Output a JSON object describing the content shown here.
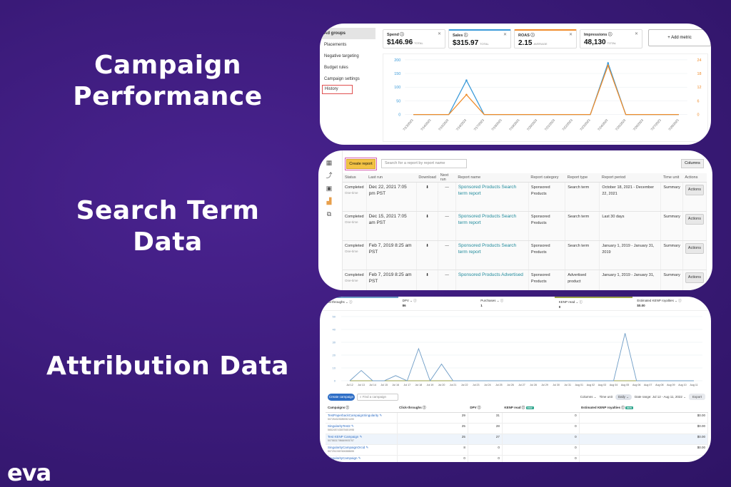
{
  "headings": {
    "campaign_performance": "Campaign Performance",
    "search_term_data": "Search Term Data",
    "attribution_data": "Attribution Data"
  },
  "logo": "eva",
  "campaign_panel": {
    "nav": [
      "Ad groups",
      "Placements",
      "Negative targeting",
      "Budget rules",
      "Campaign settings",
      "History"
    ],
    "active_nav": "Ad groups",
    "highlighted_nav": "History",
    "metrics": [
      {
        "label": "Spend",
        "value": "$146.96",
        "qualifier": "TOTAL"
      },
      {
        "label": "Sales",
        "value": "$315.97",
        "qualifier": "TOTAL",
        "color": "#3a9ad9"
      },
      {
        "label": "ROAS",
        "value": "2.15",
        "qualifier": "AVERAGE",
        "color": "#f08c2a"
      },
      {
        "label": "Impressions",
        "value": "48,130",
        "qualifier": "TOTAL"
      }
    ],
    "add_metric_label": "+ Add metric"
  },
  "search_panel": {
    "side_icons": [
      "dashboard-icon",
      "analytics-icon",
      "media-icon",
      "reports-icon",
      "copy-icon"
    ],
    "create_report_label": "Create report",
    "search_placeholder": "Search for a report by report name",
    "columns_label": "Columns",
    "headers": [
      "Status",
      "Last run",
      "Download",
      "Next run",
      "Report name",
      "Report category",
      "Report type",
      "Report period",
      "Time unit",
      "Actions"
    ],
    "rows": [
      {
        "status": "Completed",
        "frequency": "One-time",
        "last_run": "Dec 22, 2021 7:05 pm PST",
        "next_run": "—",
        "report_name": "Sponsored Products Search term report",
        "category": "Sponsored Products",
        "type": "Search term",
        "period": "October 18, 2021 - December 22, 2021",
        "time_unit": "Summary",
        "action": "Actions"
      },
      {
        "status": "Completed",
        "frequency": "One-time",
        "last_run": "Dec 15, 2021 7:05 am PST",
        "next_run": "—",
        "report_name": "Sponsored Products Search term report",
        "category": "Sponsored Products",
        "type": "Search term",
        "period": "Last 30 days",
        "time_unit": "Summary",
        "action": "Actions"
      },
      {
        "status": "Completed",
        "frequency": "One-time",
        "last_run": "Feb 7, 2019 8:25 am PST",
        "next_run": "—",
        "report_name": "Sponsored Products Search term report",
        "category": "Sponsored Products",
        "type": "Search term",
        "period": "January 1, 2019 - January 31, 2019",
        "time_unit": "Summary",
        "action": "Actions"
      },
      {
        "status": "Completed",
        "frequency": "One-time",
        "last_run": "Feb 7, 2019 8:25 am PST",
        "next_run": "—",
        "report_name": "Sponsored Products Advertised",
        "category": "Sponsored Products",
        "type": "Advertised product",
        "period": "January 1, 2019 - January 31,",
        "time_unit": "Summary",
        "action": "Actions"
      }
    ]
  },
  "attribution_panel": {
    "metric_tiles": [
      {
        "label": "Click-throughs",
        "value": ""
      },
      {
        "label": "DPV",
        "value": "86"
      },
      {
        "label": "Purchases",
        "value": "1"
      },
      {
        "label": "KENP read",
        "value": "0"
      },
      {
        "label": "Estimated KENP royalties",
        "value": "$0.00"
      }
    ],
    "create_campaign_label": "Create campaign",
    "find_placeholder": "Find a campaign",
    "columns_label": "Columns",
    "time_unit_label": "Time unit",
    "time_unit_value": "Daily",
    "date_range": "Date range: Jul 12 - Aug 11, 2022",
    "export_label": "Export",
    "badge": "NEW",
    "table_headers": [
      "Campaigns",
      "Click-throughs",
      "DPV",
      "KENP read",
      "Estimated KENP royalties"
    ],
    "rows": [
      {
        "name": "TestPaperbackCampaignSingularity",
        "id": "5072543230890921490",
        "clicks": "29",
        "dpv": "31",
        "kenp": "0",
        "royalties": "$0.00"
      },
      {
        "name": "SingularityTest2",
        "id": "5652457433575451998",
        "clicks": "25",
        "dpv": "28",
        "kenp": "0",
        "royalties": "$0.00"
      },
      {
        "name": "Test KENP Campaign",
        "id": "5075831798669905757",
        "clicks": "25",
        "dpv": "27",
        "kenp": "0",
        "royalties": "$0.00"
      },
      {
        "name": "SingularityCampaignOrcid",
        "id": "5072910367606388655",
        "clicks": "8",
        "dpv": "0",
        "kenp": "0",
        "royalties": "$0.00"
      },
      {
        "name": "SingularityCampaign",
        "id": "",
        "clicks": "0",
        "dpv": "0",
        "kenp": "0",
        "royalties": ""
      }
    ]
  },
  "chart_data": [
    {
      "type": "line",
      "title": "",
      "x": [
        "7/13/2023",
        "7/14/2023",
        "7/15/2023",
        "7/16/2023",
        "7/17/2023",
        "7/18/2023",
        "7/19/2023",
        "7/20/2023",
        "7/21/2023",
        "7/22/2023",
        "7/23/2023",
        "7/24/2023",
        "7/25/2023",
        "7/26/2023",
        "7/27/2023",
        "7/28/2023"
      ],
      "series": [
        {
          "name": "Sales",
          "axis": "left",
          "color": "#3a9ad9",
          "values": [
            0,
            0,
            0,
            125,
            0,
            0,
            0,
            0,
            0,
            0,
            0,
            188,
            0,
            0,
            0,
            0
          ]
        },
        {
          "name": "ROAS",
          "axis": "right",
          "color": "#f08c2a",
          "values": [
            0,
            0,
            0,
            8.7,
            0,
            0,
            0,
            0,
            0,
            0,
            0,
            21.5,
            0,
            0,
            0,
            0
          ]
        }
      ],
      "ylim": [
        0,
        200
      ],
      "yticks": [
        0,
        50,
        100,
        150,
        200
      ],
      "y2lim": [
        0,
        24
      ],
      "y2ticks": [
        0,
        6,
        12,
        18,
        24
      ],
      "grid": true
    },
    {
      "type": "line",
      "title": "",
      "x": [
        "Jul 12",
        "Jul 13",
        "Jul 14",
        "Jul 15",
        "Jul 16",
        "Jul 17",
        "Jul 18",
        "Jul 19",
        "Jul 20",
        "Jul 21",
        "Jul 22",
        "Jul 23",
        "Jul 24",
        "Jul 25",
        "Jul 26",
        "Jul 27",
        "Jul 28",
        "Jul 29",
        "Jul 30",
        "Jul 31",
        "Aug 01",
        "Aug 02",
        "Aug 03",
        "Aug 04",
        "Aug 05",
        "Aug 06",
        "Aug 07",
        "Aug 08",
        "Aug 09",
        "Aug 10",
        "Aug 11"
      ],
      "series": [
        {
          "name": "Click-throughs",
          "color": "#6e9cc6",
          "values": [
            0,
            8,
            0,
            0,
            4,
            0,
            25,
            0,
            13,
            0,
            0,
            0,
            0,
            0,
            0,
            0,
            0,
            0,
            0,
            0,
            0,
            0,
            0,
            0,
            37,
            0,
            0,
            0,
            0,
            0,
            0
          ]
        },
        {
          "name": "KENP read",
          "color": "#9aa048",
          "values": [
            0,
            0,
            0,
            0,
            0,
            0,
            0,
            0,
            0,
            0,
            0,
            0,
            0,
            0,
            0,
            0,
            0,
            0,
            0,
            0,
            0,
            0,
            0,
            0,
            0,
            0,
            0,
            0,
            0,
            0,
            0
          ]
        }
      ],
      "ylim": [
        0,
        50
      ],
      "yticks": [
        0,
        10,
        20,
        30,
        40,
        50
      ],
      "grid": true
    }
  ]
}
